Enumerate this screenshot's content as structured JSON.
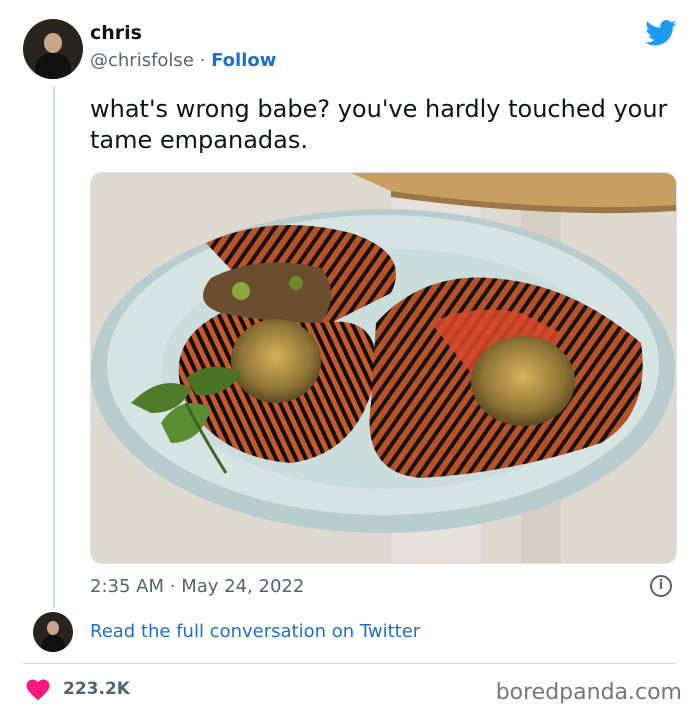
{
  "author": {
    "display_name": "chris",
    "handle": "@chrisfolse",
    "separator": "·",
    "follow_label": "Follow"
  },
  "tweet": {
    "text": "what's wrong babe? you've hardly touched your tame empanadas.",
    "time": "2:35 AM",
    "separator": "·",
    "date": "May 24, 2022"
  },
  "footer": {
    "read_more_label": "Read the full conversation on Twitter",
    "likes": "223.2K",
    "credit": "boredpanda.com"
  },
  "colors": {
    "twitter_blue": "#1d9bf0",
    "link_blue": "#1d6fc7",
    "heart": "#f91880",
    "muted": "#536471"
  },
  "icons": {
    "brand": "twitter-bird-icon",
    "info": "info-circle-icon",
    "like": "heart-icon"
  }
}
